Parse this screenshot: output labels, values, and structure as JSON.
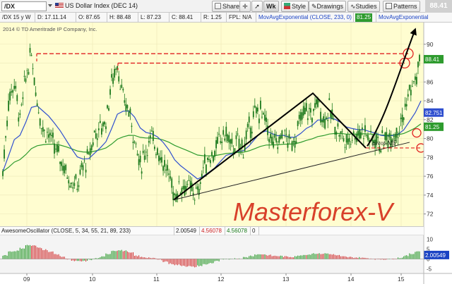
{
  "toolbar": {
    "symbol": "/DX",
    "symbol_desc": "US Dollar Index (DEC 14)",
    "buttons": {
      "share": "Share",
      "wk": "Wk",
      "style": "Style",
      "drawings": "Drawings",
      "studies": "Studies",
      "patterns": "Patterns"
    },
    "last_price": "88.41"
  },
  "infobar": {
    "period": "/DX 15 y W",
    "date": "D: 17.11.14",
    "open": "O: 87.65",
    "high": "H: 88.48",
    "low": "L: 87.23",
    "close": "C: 88.41",
    "range": "R: 1.25",
    "fpl": "FPL: N/A",
    "ma_label": "MovAvgExponential (CLOSE, 233, 0)",
    "ma_value": "81.25",
    "ma_label2": "MovAvgExponential"
  },
  "copyright": "2014 © TD Ameritrade IP Company, Inc.",
  "watermark": "Masterforex-V",
  "pivot_label": "pivot-MF",
  "colors": {
    "chart_bg": "#fffdd0",
    "candle": "#1d7a1d",
    "ema_slow": "#2e9b2e",
    "ema_fast": "#2f4fcf",
    "resistance": "#e02020",
    "watermark": "#d8402a",
    "osc_bg": "#f4f4f4"
  },
  "price_axis": {
    "ticks": [
      "90",
      "86",
      "84",
      "82",
      "80",
      "78",
      "76",
      "74",
      "72"
    ],
    "badges": {
      "last": "88.41",
      "ema_fast": "82.751",
      "ema_slow": "81.25"
    }
  },
  "osc": {
    "name": "AwesomeOscillator (CLOSE, 5, 34, 55, 21, 89, 233)",
    "v1": "2.00549",
    "v2": "4.56078",
    "v3": "4.56078",
    "v4": "0",
    "ticks": [
      "10",
      "5",
      "0",
      "-5"
    ],
    "badge": "2.00549"
  },
  "time_axis": [
    "09",
    "10",
    "11",
    "12",
    "13",
    "14",
    "15"
  ],
  "chart_data": {
    "type": "candlestick",
    "title": "US Dollar Index (DEC 14)",
    "timeframe": "weekly",
    "ylim": [
      71,
      92
    ],
    "x": [
      "2008-08",
      "2008-10",
      "2008-12",
      "2009-01",
      "2009-02",
      "2009-03",
      "2009-04",
      "2009-05",
      "2009-06",
      "2009-07",
      "2009-08",
      "2009-09",
      "2009-10",
      "2009-11",
      "2009-12",
      "2010-01",
      "2010-02",
      "2010-03",
      "2010-04",
      "2010-05",
      "2010-06",
      "2010-07",
      "2010-08",
      "2010-09",
      "2010-10",
      "2010-11",
      "2010-12",
      "2011-01",
      "2011-02",
      "2011-03",
      "2011-04",
      "2011-05",
      "2011-06",
      "2011-07",
      "2011-08",
      "2011-09",
      "2011-10",
      "2011-11",
      "2011-12",
      "2012-01",
      "2012-02",
      "2012-03",
      "2012-04",
      "2012-05",
      "2012-06",
      "2012-07",
      "2012-08",
      "2012-09",
      "2012-10",
      "2012-11",
      "2012-12",
      "2013-01",
      "2013-02",
      "2013-03",
      "2013-04",
      "2013-05",
      "2013-06",
      "2013-07",
      "2013-08",
      "2013-09",
      "2013-10",
      "2013-11",
      "2013-12",
      "2014-01",
      "2014-02",
      "2014-03",
      "2014-04",
      "2014-05",
      "2014-06",
      "2014-07",
      "2014-08",
      "2014-09",
      "2014-10",
      "2014-11"
    ],
    "close": [
      76.5,
      84.0,
      86.0,
      82.0,
      86.5,
      89.0,
      84.0,
      81.0,
      80.5,
      79.0,
      78.0,
      76.5,
      75.5,
      75.0,
      77.0,
      78.0,
      80.5,
      81.0,
      82.0,
      86.0,
      88.0,
      84.0,
      83.0,
      80.0,
      77.0,
      79.0,
      80.0,
      79.0,
      77.5,
      76.0,
      74.0,
      75.0,
      75.0,
      74.5,
      74.0,
      77.0,
      78.0,
      78.5,
      80.0,
      80.5,
      79.0,
      79.5,
      79.0,
      81.0,
      82.5,
      83.0,
      81.5,
      79.5,
      79.5,
      80.5,
      79.5,
      80.0,
      82.0,
      83.0,
      82.5,
      84.0,
      82.0,
      83.0,
      81.5,
      80.5,
      79.5,
      80.5,
      80.5,
      81.0,
      80.0,
      80.0,
      79.5,
      80.0,
      80.5,
      81.0,
      82.5,
      85.0,
      86.0,
      88.4
    ],
    "ema_fast_label": "MovAvgExponential",
    "ema_slow_label": "MovAvgExponential (CLOSE, 233, 0)",
    "ema_fast_last": 82.751,
    "ema_slow_last": 81.25,
    "last_close": 88.41,
    "resistance_levels": [
      89.0,
      88.0
    ],
    "trendline_annotation": "pivot-MF",
    "oscillator": {
      "name": "AwesomeOscillator (CLOSE, 5, 34, 55, 21, 89, 233)",
      "ylim": [
        -7,
        12
      ],
      "last": 2.00549
    }
  }
}
